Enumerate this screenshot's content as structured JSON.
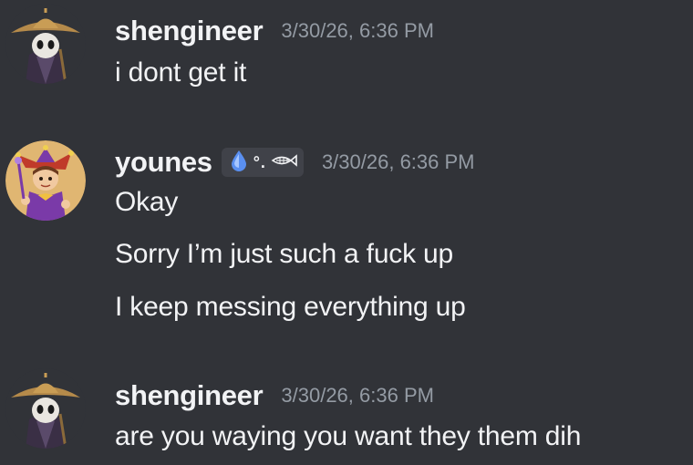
{
  "messages": [
    {
      "username": "shengineer",
      "timestamp": "3/30/26, 6:36 PM",
      "lines": [
        "i dont get it"
      ]
    },
    {
      "username": "younes",
      "timestamp": "3/30/26, 6:36 PM",
      "badge": {
        "icon": "water-drop-icon",
        "text": "°.",
        "icon2": "fish-icon"
      },
      "lines": [
        "Okay",
        "Sorry I’m just such a fuck up",
        "I keep messing everything up"
      ]
    },
    {
      "username": "shengineer",
      "timestamp": "3/30/26, 6:36 PM",
      "lines": [
        "are you waying you want they them dih"
      ]
    }
  ],
  "colors": {
    "background": "#313338",
    "username": "#f2f3f5",
    "timestamp": "#949ba4",
    "message_text": "#f2f3f5",
    "badge_bg": "#404249"
  }
}
